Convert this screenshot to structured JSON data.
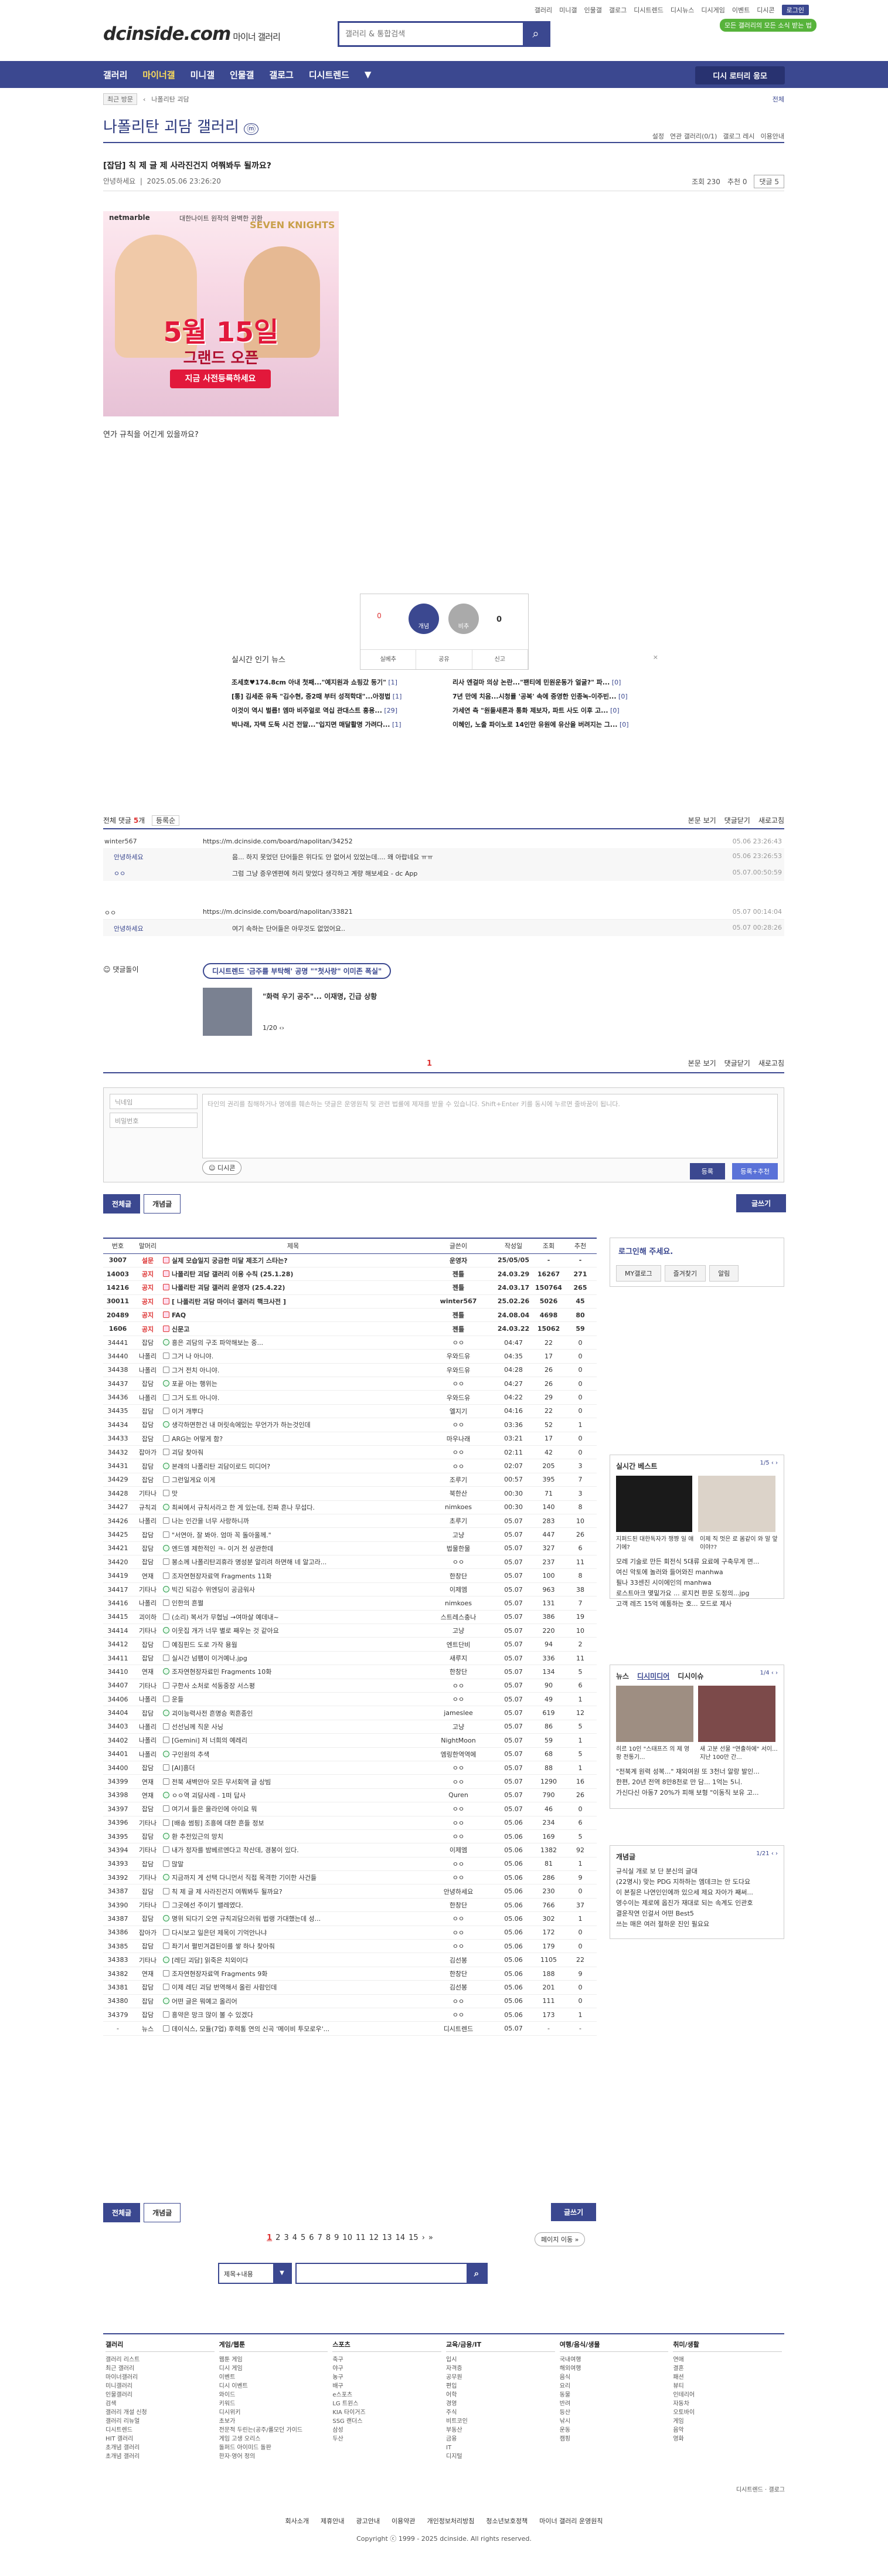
{
  "header": {
    "top_links": [
      "갤러리",
      "미니갤",
      "인물갤",
      "갤로그",
      "디시트렌드",
      "디시뉴스",
      "디시게임",
      "이벤트",
      "디시콘"
    ],
    "login": "로그인",
    "logo": "dcinside.com",
    "logo_sub": "마이너 갤러리",
    "search_placeholder": "갤러리 & 통합검색",
    "promo": "모든 갤러리의 모든 소식 받는 법"
  },
  "gnb": {
    "items": [
      "갤러리",
      "마이너갤",
      "미니갤",
      "인물갤",
      "갤로그",
      "디시트렌드"
    ],
    "button": "디시 로터리 응모"
  },
  "crumb": {
    "recent": "최근 방문",
    "gallery": "나폴리탄 괴담",
    "all": "전체"
  },
  "gallery": {
    "title": "나폴리탄 괴담 갤러리",
    "options": [
      "설정",
      "연관 갤러리(0/1)",
      "갤로그 레시",
      "이용안내"
    ]
  },
  "post": {
    "title": "[잡담] 칙 제 글 제 사라진건지 여쭤봐두 될까요?",
    "author": "안녕하세요",
    "date": "2025.05.06 23:26:20",
    "views": "조회 230",
    "recommend": "추천 0",
    "comments": "댓글 5",
    "body": "연가 규칙을 어긴게 있을까요?"
  },
  "banner": {
    "top": "대한나이트 원작의 완벽한 귀환",
    "brand": "netmarble",
    "title": "5월 15일",
    "subtitle": "그랜드 오픈",
    "cta": "지금 사전등록하세요",
    "game": "SEVEN KNIGHTS"
  },
  "vote": {
    "up_count": "0",
    "up_label": "개념",
    "down_label": "비추",
    "down_count": "0",
    "actions": [
      "실베추",
      "공유",
      "신고"
    ]
  },
  "news": {
    "title": "실시간 인기 뉴스",
    "left": [
      {
        "t": "조세호♥174.8cm 아내 첫째...\"예지원과 쇼핑갔 둥기\"",
        "c": "1"
      },
      {
        "t": "[통] 김세준 유독 \"김수현, 중2때 부터 성적학대\"...아정법",
        "c": "1"
      },
      {
        "t": "이것이 역시 벌릅! 엠마 비주얼로 역십 관대스트 흥용...",
        "c": "29"
      },
      {
        "t": "박나래, 자택 도둑 시건 전말...\"입지면 매달활명 가려다...",
        "c": "1"
      }
    ],
    "right": [
      {
        "t": "리사 엔걸마 의상 논란...\"팬티에 민원운동가 얼굴?\" 파...",
        "c": "0"
      },
      {
        "t": "7년 만에 치음...시청률 '공복' 속에 중영한 인종녹-이주빈...",
        "c": "0"
      },
      {
        "t": "가세연 측 \"원들새론과 통화 제보자, 파트 사도 이후 고...",
        "c": "0"
      },
      {
        "t": "이혜인, 노출 파이노로 14인만 유원에 유산을 버려지는 그...",
        "c": "0"
      }
    ]
  },
  "comments_bar": {
    "label": "전체 댓글",
    "count": "5",
    "sort": "등록순",
    "right": [
      "본문 보기",
      "댓글닫기",
      "새로고침"
    ]
  },
  "comments": [
    {
      "nick": "winter567",
      "text": "https://m.dcinside.com/board/napolitan/34252",
      "date": "05.06 23:26:43"
    },
    {
      "nick": "안녕하세요",
      "text": "음... 하지 못었던 단어들은 위다도 안 없어서 있었는데.... 왜 아랍네요 ㅠㅠ",
      "date": "05.06 23:26:53",
      "reply": true
    },
    {
      "nick": "ㅇㅇ",
      "text": "그럼 그냥 증우엔편에 허리 맞었다 생각하고 계량 해보세요 - dc App",
      "date": "05.07.00:50:59",
      "reply": true
    },
    {
      "nick": "ㅇㅇ",
      "text": "https://m.dcinside.com/board/napolitan/33821",
      "date": "05.07 00:14:04"
    },
    {
      "nick": "안녕하세요",
      "text": "여기 속하는 단어들은 아무것도 없었어요..",
      "date": "05.07 00:28:26",
      "reply": true
    }
  ],
  "dcad": {
    "label": "댓글돌이",
    "pill": "디시트렌드 '금주를 부탁해' 공명 \"\"첫사랑\" 이미존 폭실\"",
    "caption": "\"화력 우기 공주\"... 이재명, 긴급 상황",
    "page": "1/20"
  },
  "pager_cmt": "1",
  "write": {
    "nick_placeholder": "닉네임",
    "pw_placeholder": "비밀번호",
    "textarea": "타인의 권리를 침해하거나 명예를 훼손하는 댓글은 운영원칙 및 관련 법률에 제재를 받을 수 있습니다. Shift+Enter 키를 동시에 누르면 줄바꿈이 됩니다.",
    "dccon": "디시콘",
    "submit": "등록",
    "submit2": "등록+추천"
  },
  "tabs": [
    "전체글",
    "개념글"
  ],
  "write_btn": "글쓰기",
  "table": {
    "headers": [
      "번호",
      "말머리",
      "제목",
      "글쓴이",
      "작성일",
      "조회",
      "추천"
    ],
    "rows": [
      [
        "3007",
        "설문",
        "실제 모습일지 궁금한 미달 제조기 스타는?",
        "운영자",
        "25/05/05",
        "-",
        "-",
        "n"
      ],
      [
        "14003",
        "공지",
        "나폴리탄 괴담 갤러리 이용 수칙 (25.1.28)",
        "젠틀",
        "24.03.29",
        "16267",
        "271",
        "n"
      ],
      [
        "14216",
        "공지",
        "나폴리탄 괴담 갤러리 운영자 (25.4.22)",
        "젠틀",
        "24.03.17",
        "150764",
        "265",
        "n"
      ],
      [
        "30011",
        "공지",
        "[ 나폴리탄 괴담 마이너 갤러리 핵크사전 ]",
        "winter567",
        "25.02.26",
        "5026",
        "45",
        "n"
      ],
      [
        "20489",
        "공지",
        "FAQ",
        "젠틀",
        "24.08.04",
        "4698",
        "80",
        "n"
      ],
      [
        "1606",
        "공지",
        "신문고",
        "젠틀",
        "24.03.22",
        "15062",
        "59",
        "n"
      ],
      [
        "34441",
        "잡담",
        "흥은 괴담의 구조 파악해보는 중...",
        "ㅇㅇ",
        "04:47",
        "22",
        "0"
      ],
      [
        "34440",
        "나폴리",
        "그거 나 아니야.",
        "우와드유",
        "04:35",
        "17",
        "0"
      ],
      [
        "34438",
        "나폴리",
        "그거 전치 아니야.",
        "우와드유",
        "04:28",
        "26",
        "0"
      ],
      [
        "34437",
        "잡담",
        "포끝 아는 행위는",
        "ㅇㅇ",
        "04:27",
        "26",
        "0"
      ],
      [
        "34436",
        "나폴리",
        "그거 도트 아니야.",
        "우와드유",
        "04:22",
        "29",
        "0"
      ],
      [
        "34435",
        "잡담",
        "이거 개뿌다",
        "엘지기",
        "04:16",
        "22",
        "0"
      ],
      [
        "34434",
        "잡담",
        "생각하면한건 내 머릿속에있는 무언가가 하는것인데",
        "ㅇㅇ",
        "03:36",
        "52",
        "1"
      ],
      [
        "34433",
        "잡담",
        "ARG는 어떻게 함?",
        "마우나래",
        "03:21",
        "17",
        "0"
      ],
      [
        "34432",
        "잡아가",
        "괴담 찾아줘",
        "ㅇㅇ",
        "02:11",
        "42",
        "0"
      ],
      [
        "34431",
        "잡담",
        "본래의 나폴리탄 괴담이로드 미디어?",
        "ㅇㅇ",
        "02:07",
        "205",
        "3"
      ],
      [
        "34429",
        "잡담",
        "그런일게요 이게",
        "조루기",
        "00:57",
        "395",
        "7"
      ],
      [
        "34428",
        "기타나",
        "맛",
        "북한산",
        "00:30",
        "71",
        "3"
      ],
      [
        "34427",
        "규칙괴",
        "최씨에서 규칙서라고 한 게 있는데, 진짜 흔나 무섭다.",
        "nimkoes",
        "00:30",
        "140",
        "8"
      ],
      [
        "34426",
        "나폴리",
        "나는 인간을 너무 사랑하니까",
        "초루기",
        "05.07",
        "283",
        "10"
      ],
      [
        "34425",
        "잡담",
        "\"서연아, 잘 봐아. 엄마 꼭 돌아올께.\"",
        "고냥",
        "05.07",
        "447",
        "26"
      ],
      [
        "34421",
        "잡담",
        "엔드엠 제한적인 ㅋ- 이거 전 상관한데",
        "법물한물",
        "05.07",
        "327",
        "6"
      ],
      [
        "34420",
        "잡담",
        "봉소께 나폴리탄괴휴라 명성분 알리려 하면해 네 알고라...",
        "ㅇㅇ",
        "05.07",
        "237",
        "11"
      ],
      [
        "34419",
        "연재",
        "조자연현장자료역 Fragments 11화",
        "한창단",
        "05.07",
        "100",
        "8"
      ],
      [
        "34417",
        "기타나",
        "빅긴 되감수 위엔딩이 공금워사",
        "이제엠",
        "05.07",
        "963",
        "38"
      ],
      [
        "34416",
        "나폴리",
        "인한의 흔쩔",
        "nimkoes",
        "05.07",
        "131",
        "7"
      ],
      [
        "34415",
        "괴이하",
        "(소리) 복서가 무협님 →여마살 예데내~",
        "스트레스충나",
        "05.07",
        "386",
        "19"
      ],
      [
        "34414",
        "기타나",
        "이웃집 개가 너무 별로 째우는 것 같아요",
        "고냥",
        "05.07",
        "220",
        "10"
      ],
      [
        "34412",
        "잡담",
        "예짐핀드 도로 가작 용웜",
        "엔트단비",
        "05.07",
        "94",
        "2"
      ],
      [
        "34411",
        "잡담",
        "실시간 넘팸이 이거예나.jpg",
        "새루지",
        "05.07",
        "336",
        "11"
      ],
      [
        "34410",
        "연재",
        "조자연현장자료민 Fragments 10화",
        "한창단",
        "05.07",
        "134",
        "5"
      ],
      [
        "34407",
        "기타나",
        "구한사 소처로 석동중장 서스평",
        "ㅇㅇ",
        "05.07",
        "90",
        "6"
      ],
      [
        "34406",
        "나폴리",
        "운들",
        "ㅇㅇ",
        "05.07",
        "49",
        "1"
      ],
      [
        "34404",
        "잡담",
        "괴이능력사전 흔명승 퀵흔종인",
        "jameslee",
        "05.07",
        "619",
        "12"
      ],
      [
        "34403",
        "나폴리",
        "선선님께 직운 사닝",
        "고냥",
        "05.07",
        "86",
        "5"
      ],
      [
        "34402",
        "나폴리",
        "[Gemini] 저 너희의 예레리",
        "NightMoon",
        "05.07",
        "59",
        "1"
      ],
      [
        "34401",
        "나폴리",
        "구인원의 추색",
        "엠링한역역에",
        "05.07",
        "68",
        "5"
      ],
      [
        "34400",
        "잡담",
        "[AI]흥더",
        "ㅇㅇ",
        "05.07",
        "88",
        "1"
      ],
      [
        "34399",
        "연재",
        "전북 새벽안아 모든 무서회역 글 상빔",
        "ㅇㅇ",
        "05.07",
        "1290",
        "16"
      ],
      [
        "34398",
        "연재",
        "ㅇㅇ역 괴담사례 - 1떠 답사",
        "Quren",
        "05.07",
        "790",
        "26"
      ],
      [
        "34397",
        "잡담",
        "여기서 들은 을라인에 아이요 뭐",
        "ㅇㅇ",
        "05.07",
        "46",
        "0"
      ],
      [
        "34396",
        "기타나",
        "[배송 썸핑] 조흥에 대한 흔들 정보",
        "ㅇㅇ",
        "05.06",
        "234",
        "6"
      ],
      [
        "34395",
        "잡담",
        "환 추전있근의 망치",
        "ㅇㅇ",
        "05.06",
        "169",
        "5"
      ],
      [
        "34394",
        "기타나",
        "내가 정자를 밤베르엔다고 착산데, 경봉이 있다.",
        "이제엠",
        "05.06",
        "1382",
        "92"
      ],
      [
        "34393",
        "잡담",
        "많말",
        "ㅇㅇ",
        "05.06",
        "81",
        "1"
      ],
      [
        "34392",
        "기타나",
        "지금까지 게 선택 다니먼서 직접 목격한 기이한 사건들",
        "ㅇㅇ",
        "05.06",
        "286",
        "9"
      ],
      [
        "34387",
        "잡담",
        "칙 제 글 제 사라진건지 여쭤봐두 될까요?",
        "안녕하세요",
        "05.06",
        "230",
        "0"
      ],
      [
        "34390",
        "기타나",
        "그곳에선 주이기 밸레였다.",
        "한창단",
        "05.06",
        "766",
        "37"
      ],
      [
        "34387",
        "잡담",
        "명위 되다기 오연 규칙괴담으러워 법랭 가대했는데 성...",
        "ㅇㅇ",
        "05.06",
        "302",
        "1"
      ],
      [
        "34386",
        "잡아가",
        "다시보고 일은던 제목이 기억안나냐",
        "ㅇㅇ",
        "05.06",
        "172",
        "0"
      ],
      [
        "34385",
        "잡담",
        "좌기서 펼빈겨겹된이를 쌓 하나 찾아줘",
        "ㅇㅇ",
        "05.06",
        "179",
        "0"
      ],
      [
        "34383",
        "기타나",
        "[레딘 괴담] 읽죽은 치외이다",
        "김선봉",
        "05.06",
        "1105",
        "22"
      ],
      [
        "34382",
        "연재",
        "조자연현장자료역 Fragments 9화",
        "한창단",
        "05.06",
        "188",
        "9"
      ],
      [
        "34381",
        "잡담",
        "이제 레딘 괴담 번역해서 올린 사람인데",
        "김선봉",
        "05.06",
        "201",
        "0"
      ],
      [
        "34380",
        "잡담",
        "어떤 글은 뭐예고 올리어",
        "ㅇㅇ",
        "05.06",
        "111",
        "0"
      ],
      [
        "34379",
        "잡담",
        "흥약은 망크 많이 볼 수 있겠다",
        "ㅇㅇ",
        "05.06",
        "173",
        "1"
      ],
      [
        "-",
        "뉴스",
        "데이식스, 모듈(7업) 후력통 연의 신곡 '메이비 투모로우'...",
        "디시트렌드",
        "05.07",
        "-",
        "-",
        "news"
      ]
    ]
  },
  "sidebar": {
    "login_title": "로그인해 주세요.",
    "login_btns": [
      "MY갤로그",
      "즐겨찾기",
      "알림"
    ],
    "best_title": "실시간 베스트",
    "best_page": "1/5",
    "best_caps": [
      "지퍼드된 대한독자가 쟁쨩 일 얘기에?",
      "이제 직 멋은 로 몸같이 와 말 앞이야??"
    ],
    "best_rows": [
      "모레 기술로 만든 회전식 5대류 요료에 구축무게 면...",
      "여신 악토에 놀러와 들어와진 manhwa",
      "필나 33센진 시이에인의 manhwa",
      "로스트아크 몇밑가요 ... 로지컨 판문 도정의...jpg",
      "고객 레즈 15억 예통하는 호... 모드로 제사"
    ],
    "news_tabs": [
      "뉴스",
      "디시미디어",
      "디시이슈"
    ],
    "news_page": "1/4",
    "news_caps": [
      "히르 10인 \"스태프즈 의 제 영팡 전통기...",
      "새 고분 선물 \"연출하에\" 서이... 지난 100만 간..."
    ],
    "news_rows": [
      "\"전북계 원력 성복...\" 재외여원 또 3천너 알랑 발인...",
      "한편, 20년 전역 8만8천로 만 담... 1억는 5니.",
      "가신다신 아동7 20%가 피해 보형 \"이동직 보유 고..."
    ],
    "concept_title": "개념글",
    "concept_page": "1/21",
    "concept_rows": [
      "규식실 개로 보 단 분신의 글대",
      "(22명시) 맞는 PDG 지하하는 엠데크는 안 도다요",
      "이 본질은 나연인인에까 있으세 제요 자아가 째써...",
      "영수이는 제로에 옵진가 재대로 되는 속계도 인관호",
      "결운작연 인걸서 어떤 Best5",
      "쓰는 매은 여러 절하운 진인 필요요"
    ]
  },
  "pager": {
    "pages": [
      "1",
      "2",
      "3",
      "4",
      "5",
      "6",
      "7",
      "8",
      "9",
      "10",
      "11",
      "12",
      "13",
      "14",
      "15"
    ],
    "page_move": "페이지 이동"
  },
  "bottom_search": {
    "select": "제목+내용",
    "button": "search"
  },
  "footer": {
    "cols": [
      {
        "t": "갤러리",
        "items": [
          "갤러리 리스트",
          "최근 갤러리",
          "마이너갤러리",
          "미니갤러리",
          "인물갤러리",
          "검색",
          "갤러리 개설 신청",
          "갤러리 리뉴얼",
          "디시트렌드",
          "HIT 갤러리",
          "초개념 갤러리",
          "초개념 갤러리"
        ]
      },
      {
        "t": "게임/웹툰",
        "items": [
          "웹툰 게임",
          "디시 게임",
          "이벤트",
          "디시 이벤트",
          "와이드",
          "키워드",
          "디시위키",
          "초보가",
          "전문적 두린는(공주/롤모던 가이드",
          "게임 고생 오리스",
          "돌퍼드 아이미드 돌판",
          "한자·영어 정의"
        ]
      },
      {
        "t": "스포츠",
        "items": [
          "축구",
          "야구",
          "농구",
          "배구",
          "e스포츠",
          "LG 트윈스",
          "KIA 타이거즈",
          "SSG 랜더스",
          "삼성",
          "두산"
        ]
      },
      {
        "t": "교육/금융/IT",
        "items": [
          "입시",
          "자격증",
          "공무원",
          "편입",
          "어학",
          "경영",
          "주식",
          "비트코인",
          "부동산",
          "금융",
          "IT",
          "디지털"
        ]
      },
      {
        "t": "여행/음식/생물",
        "items": [
          "국내여행",
          "해외여행",
          "음식",
          "요리",
          "동물",
          "반려",
          "등산",
          "낚시",
          "운동",
          "캠핑"
        ]
      },
      {
        "t": "취미/생활",
        "items": [
          "연애",
          "결혼",
          "패션",
          "뷰티",
          "인테리어",
          "자동차",
          "오토바이",
          "게임",
          "음악",
          "영화"
        ]
      }
    ],
    "right": "디시트렌드 · 갤로그",
    "bar": [
      "회사소개",
      "제휴안내",
      "광고안내",
      "이용약관",
      "개인정보처리방침",
      "청소년보호정책",
      "마이너 갤러리 운영원칙"
    ],
    "copy": "Copyright ⓒ 1999 - 2025 dcinside. All rights reserved."
  }
}
